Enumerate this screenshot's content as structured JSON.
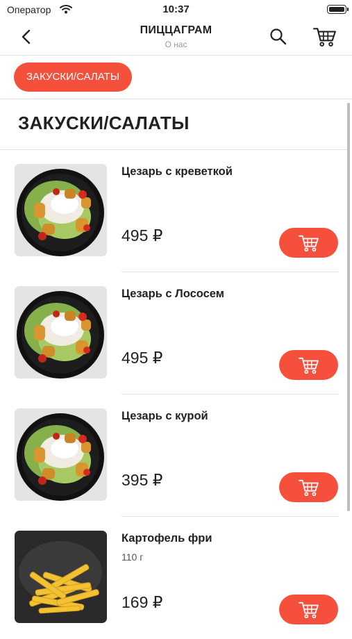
{
  "status_bar": {
    "carrier": "Оператор",
    "time": "10:37"
  },
  "nav": {
    "title": "ПИЦЦАГРАМ",
    "subtitle": "О нас"
  },
  "category": {
    "chip_label": "ЗАКУСКИ/САЛАТЫ"
  },
  "section": {
    "title": "ЗАКУСКИ/САЛАТЫ"
  },
  "products": [
    {
      "name": "Цезарь с креветкой",
      "weight": "",
      "price": "495 ₽",
      "image": "caesar-salad-icon"
    },
    {
      "name": "Цезарь с Лососем",
      "weight": "",
      "price": "495 ₽",
      "image": "caesar-salad-icon"
    },
    {
      "name": "Цезарь с курой",
      "weight": "",
      "price": "395 ₽",
      "image": "caesar-salad-icon"
    },
    {
      "name": "Картофель фри",
      "weight": "110 г",
      "price": "169 ₽",
      "image": "french-fries-icon"
    }
  ],
  "colors": {
    "accent": "#f4503c",
    "divider": "#e2e2e2"
  }
}
